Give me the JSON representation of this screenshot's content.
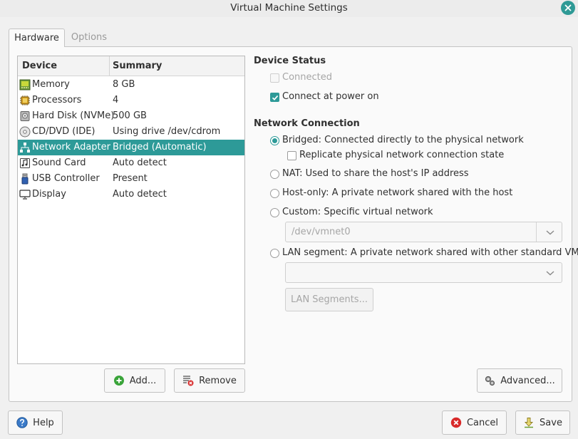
{
  "window": {
    "title": "Virtual Machine Settings",
    "close_icon": "close-icon",
    "accent_color": "#2d9a98"
  },
  "tabs": [
    {
      "label": "Hardware",
      "selected": true
    },
    {
      "label": "Options",
      "selected": false
    }
  ],
  "devices": {
    "headers": {
      "device": "Device",
      "summary": "Summary"
    },
    "rows": [
      {
        "name": "Memory",
        "summary": "8 GB",
        "icon": "memory-icon",
        "selected": false
      },
      {
        "name": "Processors",
        "summary": "4",
        "icon": "processor-icon",
        "selected": false
      },
      {
        "name": "Hard Disk (NVMe)",
        "summary": "500 GB",
        "icon": "hard-disk-icon",
        "selected": false
      },
      {
        "name": "CD/DVD (IDE)",
        "summary": "Using drive /dev/cdrom",
        "icon": "cd-dvd-icon",
        "selected": false
      },
      {
        "name": "Network Adapter",
        "summary": "Bridged (Automatic)",
        "icon": "network-adapter-icon",
        "selected": true
      },
      {
        "name": "Sound Card",
        "summary": "Auto detect",
        "icon": "sound-card-icon",
        "selected": false
      },
      {
        "name": "USB Controller",
        "summary": "Present",
        "icon": "usb-controller-icon",
        "selected": false
      },
      {
        "name": "Display",
        "summary": "Auto detect",
        "icon": "display-icon",
        "selected": false
      }
    ],
    "add_label": "Add...",
    "remove_label": "Remove"
  },
  "device_status": {
    "heading": "Device Status",
    "connected": {
      "label": "Connected",
      "checked": false,
      "disabled": true
    },
    "connect_at_power_on": {
      "label": "Connect at power on",
      "checked": true
    }
  },
  "network_connection": {
    "heading": "Network Connection",
    "bridged": {
      "label": "Bridged: Connected directly to the physical network",
      "selected": true
    },
    "replicate": {
      "label": "Replicate physical network connection state",
      "checked": false
    },
    "nat": {
      "label": "NAT: Used to share the host's IP address",
      "selected": false
    },
    "host_only": {
      "label": "Host-only: A private network shared with the host",
      "selected": false
    },
    "custom": {
      "label": "Custom: Specific virtual network",
      "selected": false,
      "value": "/dev/vmnet0"
    },
    "lan_segment": {
      "label": "LAN segment: A private network shared with other standard VMs",
      "selected": false,
      "value": ""
    },
    "lan_segments_button": "LAN Segments..."
  },
  "advanced_label": "Advanced...",
  "footer": {
    "help_label": "Help",
    "cancel_label": "Cancel",
    "save_label": "Save"
  }
}
